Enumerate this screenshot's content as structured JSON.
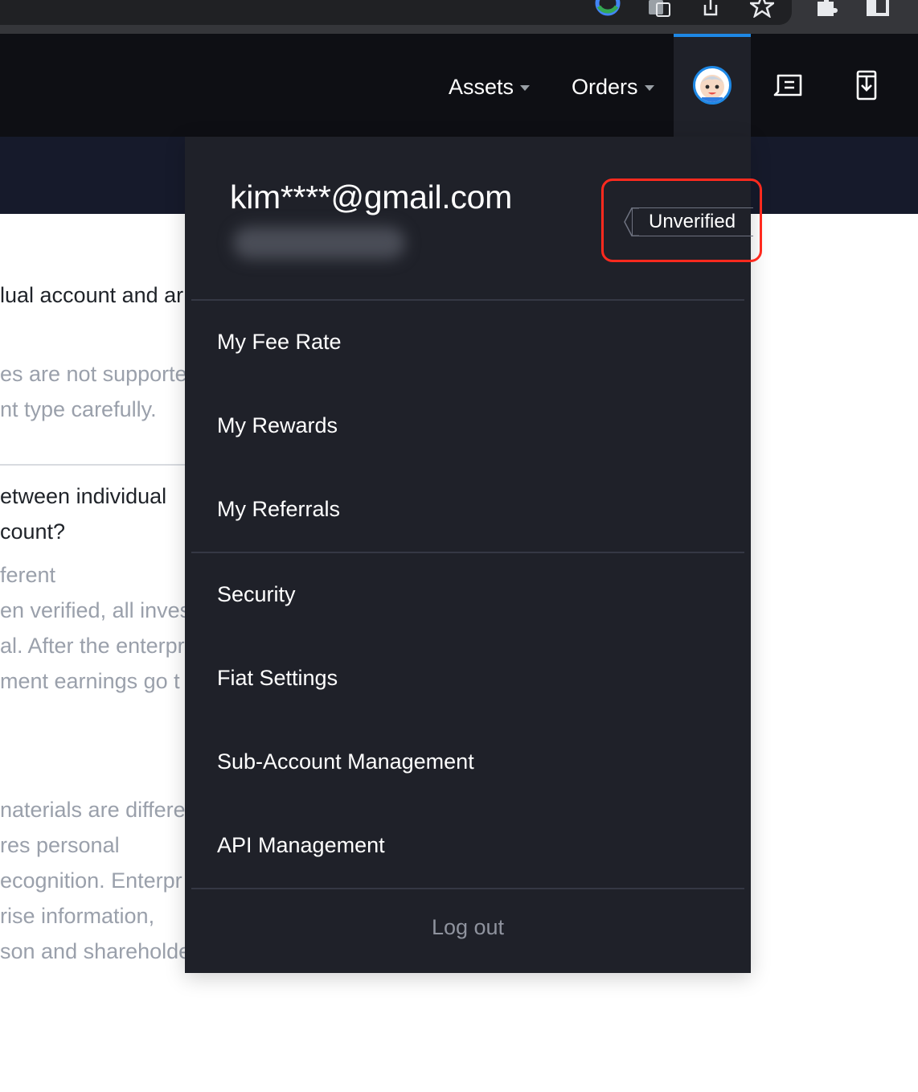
{
  "browser": {
    "toolbar_icons": [
      "google-icon",
      "translate-icon",
      "share-icon",
      "bookmark-star-icon",
      "extensions-puzzle-icon",
      "side-panel-icon"
    ]
  },
  "header": {
    "assets_label": "Assets",
    "orders_label": "Orders",
    "avatar_icon": "user-avatar-icon",
    "messages_icon": "messages-icon",
    "download_icon": "download-app-icon",
    "accent_color": "#1e88e5"
  },
  "background_page": {
    "lines": [
      "lual account and ar",
      "es are not supporte",
      "nt type carefully.",
      "etween individual",
      "count?",
      "ferent",
      "en verified, all inves",
      "al. After the enterpr",
      "ment earnings go t",
      "naterials are differe",
      "res personal",
      "ecognition. Enterpr",
      "rise information,",
      "son and shareholde"
    ]
  },
  "account_menu": {
    "email": "kim****@gmail.com",
    "verification_status": "Unverified",
    "highlight_color": "#ff2a1e",
    "items": [
      "My Fee Rate",
      "My Rewards",
      "My Referrals",
      "Security",
      "Fiat Settings",
      "Sub-Account Management",
      "API Management"
    ],
    "logout_label": "Log out"
  }
}
